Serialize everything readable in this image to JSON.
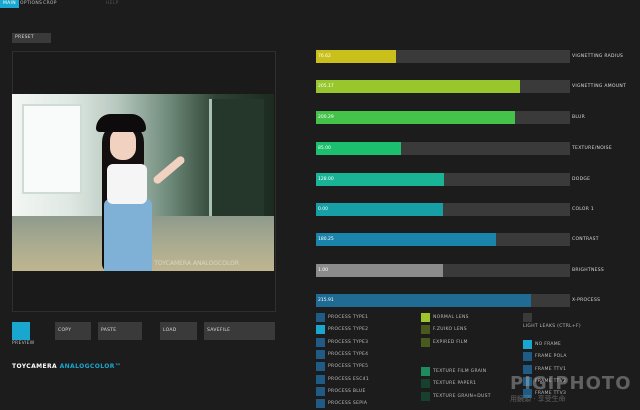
{
  "tabs": [
    "Main",
    "Options",
    "Crop",
    "Help"
  ],
  "preset_label": "Preset",
  "buttons": {
    "preview": "Preview",
    "copy": "Copy",
    "paste": "Paste",
    "load": "Load",
    "savefile": "Savefile"
  },
  "logo": {
    "part1": "TOYCAMERA ",
    "part2": "ANALOGCOLOR™"
  },
  "photo_watermark": "TOYCAMERA ANALOGCOLOR",
  "sliders": [
    {
      "label": "Vignetting Radius",
      "value_text": "76.62",
      "fraction": 0.316,
      "color": "#c9c01c"
    },
    {
      "label": "Vignetting Amount",
      "value_text": "205.17",
      "fraction": 0.803,
      "color": "#97c72d"
    },
    {
      "label": "Blur",
      "value_text": "200.29",
      "fraction": 0.785,
      "color": "#45c24a"
    },
    {
      "label": "Texture/Noise",
      "value_text": "85.00",
      "fraction": 0.335,
      "color": "#1cbf6e"
    },
    {
      "label": "Dodge",
      "value_text": "128.00",
      "fraction": 0.505,
      "color": "#19b495"
    },
    {
      "label": "Color 1",
      "value_text": "0.00",
      "fraction": 0.5,
      "color": "#169fa4"
    },
    {
      "label": "Contrast",
      "value_text": "180.25",
      "fraction": 0.709,
      "color": "#1b84aa"
    },
    {
      "label": "Brightness",
      "value_text": "1.00",
      "fraction": 0.5,
      "color": "#8b8b8b"
    },
    {
      "label": "X-Process",
      "value_text": "215.91",
      "fraction": 0.846,
      "color": "#1f6b94"
    }
  ],
  "process_types": [
    {
      "label": "Process Type1",
      "color": "#1f5b85"
    },
    {
      "label": "Process Type2",
      "color": "#1aa7cf"
    },
    {
      "label": "Process Type3",
      "color": "#1f5b85"
    },
    {
      "label": "Process Type4",
      "color": "#1f5b85"
    },
    {
      "label": "Process Type5",
      "color": "#1f5b85"
    },
    {
      "label": "Process ESC41",
      "color": "#1f5b85"
    },
    {
      "label": "Process Blue",
      "color": "#1f5b85"
    },
    {
      "label": "Process Sepia",
      "color": "#1f5b85"
    }
  ],
  "lens_options": [
    {
      "label": "Normal Lens",
      "color": "#9dc52c"
    },
    {
      "label": "F.Zuiko Lens",
      "color": "#4a5a1f"
    },
    {
      "label": "Expired Film",
      "color": "#4a5a1f"
    }
  ],
  "light_leaks": {
    "label": "Light Leaks (CTRL+F)",
    "color": "#3a3a3a"
  },
  "texture_options": [
    {
      "label": "Texture Film Grain",
      "color": "#1f8a5c"
    },
    {
      "label": "Texture Paper1",
      "color": "#17402e"
    },
    {
      "label": "Texture Grain+Dust",
      "color": "#17402e"
    }
  ],
  "frame_options": [
    {
      "label": "No Frame",
      "color": "#1aa7cf"
    },
    {
      "label": "Frame Pola",
      "color": "#1f5b85"
    },
    {
      "label": "Frame TTV1",
      "color": "#1f5b85"
    },
    {
      "label": "Frame TTV2",
      "color": "#1f5b85"
    },
    {
      "label": "Frame TTV3",
      "color": "#1f5b85"
    }
  ],
  "brand_watermark": {
    "name": "PIGIPHOTO",
    "tagline": "用鏡頭 · 享受生命"
  }
}
